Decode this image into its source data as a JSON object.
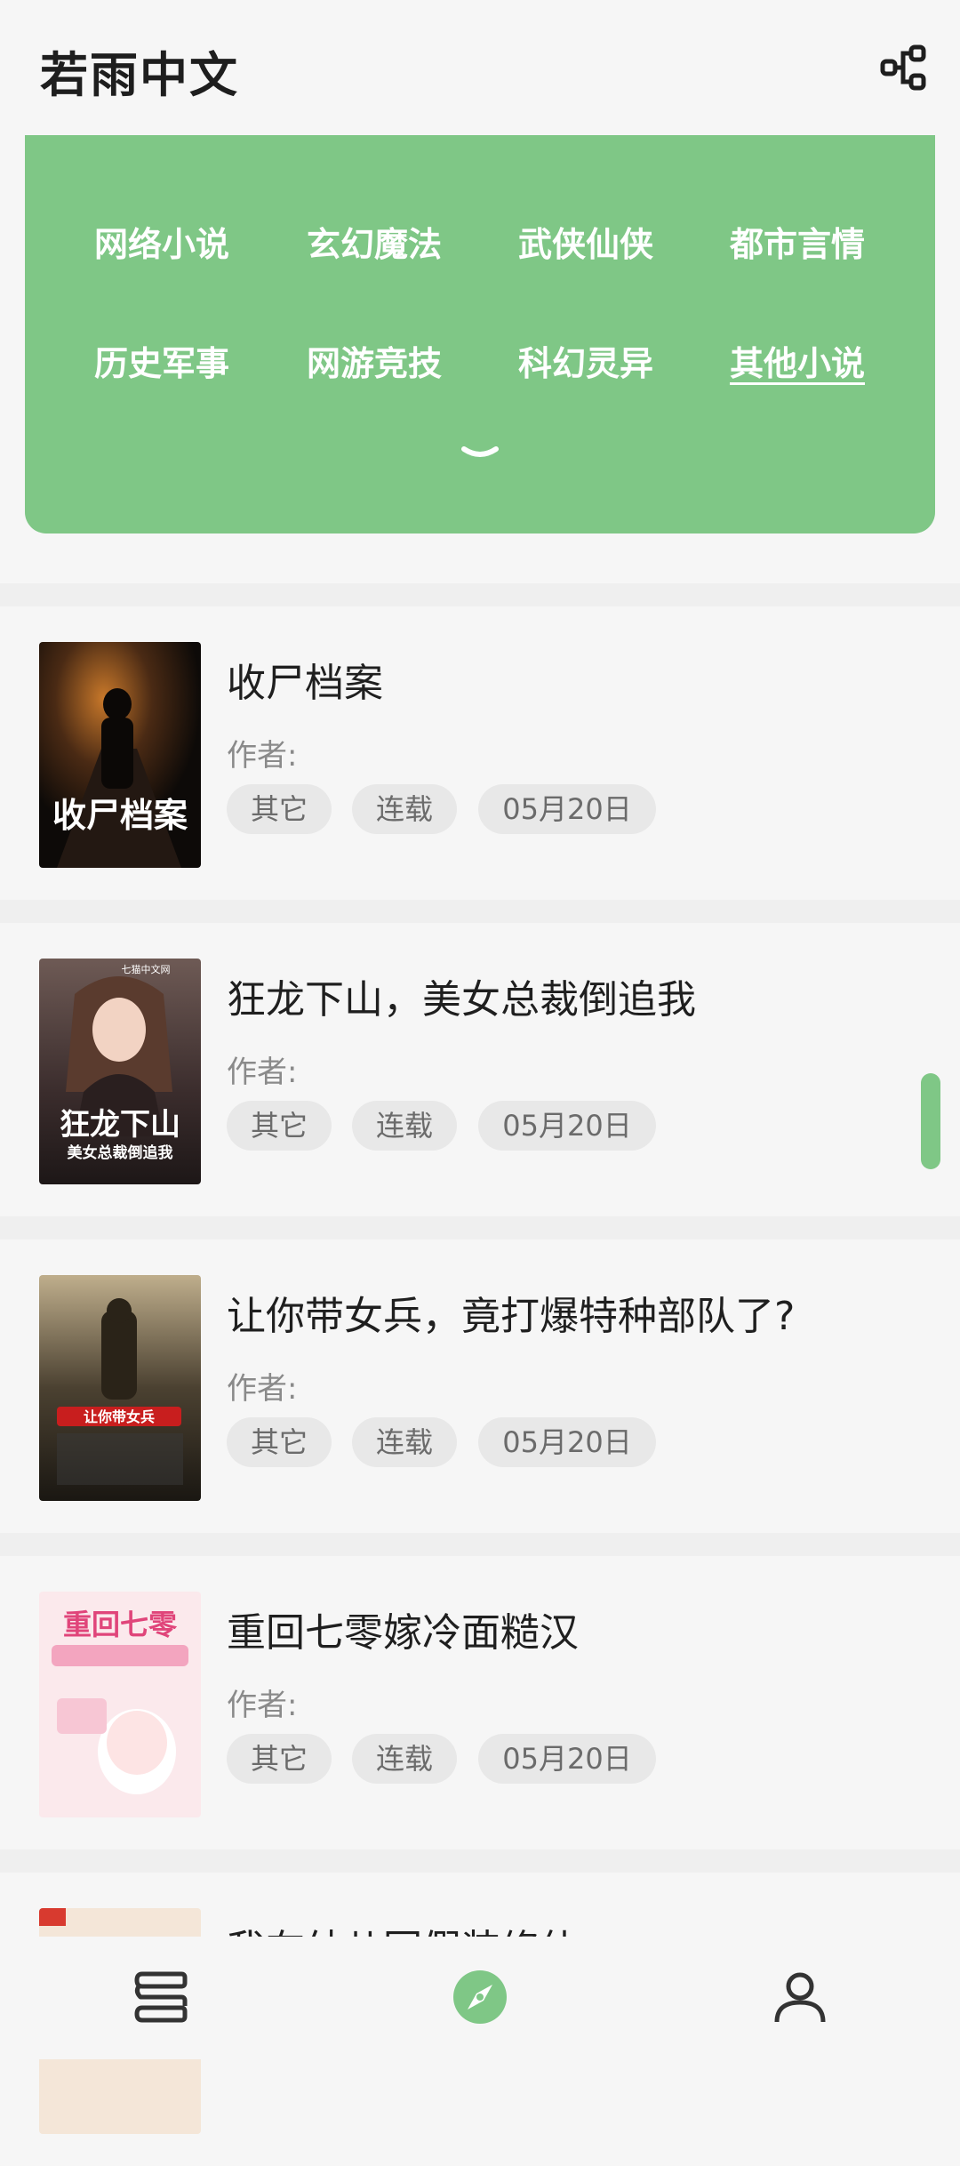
{
  "header": {
    "title": "若雨中文",
    "share_icon": "share-nodes-icon"
  },
  "categories": [
    {
      "label": "网络小说",
      "active": false
    },
    {
      "label": "玄幻魔法",
      "active": false
    },
    {
      "label": "武侠仙侠",
      "active": false
    },
    {
      "label": "都市言情",
      "active": false
    },
    {
      "label": "历史军事",
      "active": false
    },
    {
      "label": "网游竞技",
      "active": false
    },
    {
      "label": "科幻灵异",
      "active": false
    },
    {
      "label": "其他小说",
      "active": true
    }
  ],
  "books": [
    {
      "title": "收尸档案",
      "author_label": "作者:",
      "tags": [
        "其它",
        "连载",
        "05月20日"
      ],
      "cover_text": "收尸档案"
    },
    {
      "title": "狂龙下山，美女总裁倒追我",
      "author_label": "作者:",
      "tags": [
        "其它",
        "连载",
        "05月20日"
      ],
      "cover_text": "狂龙下山",
      "cover_sub": "美女总裁倒追我",
      "cover_top": "七猫中文网"
    },
    {
      "title": "让你带女兵，竟打爆特种部队了?",
      "author_label": "作者:",
      "tags": [
        "其它",
        "连载",
        "05月20日"
      ],
      "cover_text": "让你带女兵"
    },
    {
      "title": "重回七零嫁冷面糙汉",
      "author_label": "作者:",
      "tags": [
        "其它",
        "连载",
        "05月20日"
      ],
      "cover_text": "重回七零"
    },
    {
      "title": "我在幼儿园假装修仙",
      "author_label": "",
      "tags": [],
      "cover_text": ""
    }
  ],
  "tabbar": {
    "items": [
      {
        "icon": "bookshelf-icon",
        "active": false
      },
      {
        "icon": "compass-icon",
        "active": true
      },
      {
        "icon": "profile-icon",
        "active": false
      }
    ]
  },
  "colors": {
    "accent": "#7fc786",
    "tag_bg": "#e8e8e8",
    "page_bg": "#f6f6f6"
  }
}
